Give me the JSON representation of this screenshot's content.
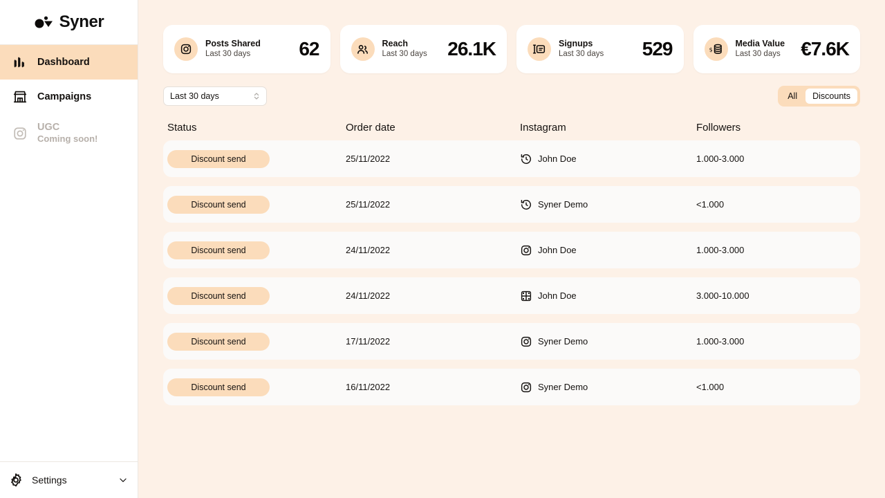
{
  "brand": {
    "name": "Syner",
    "logo_icon": "syner-logo-icon"
  },
  "colors": {
    "page_bg": "#FDF1E7",
    "accent": "#FBDCBB",
    "card_bg": "#FFFFFF",
    "row_bg": "#FBFAF9",
    "text": "#14110F",
    "muted": "#B7B0AA"
  },
  "sidebar": {
    "items": [
      {
        "label": "Dashboard",
        "icon": "bar-chart-icon",
        "active": true,
        "sub": ""
      },
      {
        "label": "Campaigns",
        "icon": "storefront-icon",
        "active": false,
        "sub": ""
      },
      {
        "label": "UGC",
        "icon": "instagram-icon",
        "active": false,
        "sub": "Coming soon!"
      }
    ],
    "footer": {
      "label": "Settings",
      "icon": "gear-icon",
      "chevron": "chevron-down-icon"
    }
  },
  "stats": [
    {
      "title": "Posts Shared",
      "subtitle": "Last 30 days",
      "value": "62",
      "icon": "instagram-icon"
    },
    {
      "title": "Reach",
      "subtitle": "Last 30 days",
      "value": "26.1K",
      "icon": "users-icon"
    },
    {
      "title": "Signups",
      "subtitle": "Last 30 days",
      "value": "529",
      "icon": "signup-card-icon"
    },
    {
      "title": "Media Value",
      "subtitle": "Last 30 days",
      "value": "€7.6K",
      "icon": "money-stack-icon"
    }
  ],
  "controls": {
    "date_filter": {
      "value": "Last 30 days",
      "icon": "stepper-icon"
    },
    "segmented": {
      "options": [
        "All",
        "Discounts"
      ],
      "selected": "Discounts"
    }
  },
  "table": {
    "columns": [
      "Status",
      "Order date",
      "Instagram",
      "Followers"
    ],
    "rows": [
      {
        "status": "Discount send",
        "date": "25/11/2022",
        "account": "John Doe",
        "icon": "story-clock-icon",
        "followers": "1.000-3.000"
      },
      {
        "status": "Discount send",
        "date": "25/11/2022",
        "account": "Syner Demo",
        "icon": "story-clock-icon",
        "followers": "<1.000"
      },
      {
        "status": "Discount send",
        "date": "24/11/2022",
        "account": "John Doe",
        "icon": "instagram-icon",
        "followers": "1.000-3.000"
      },
      {
        "status": "Discount send",
        "date": "24/11/2022",
        "account": "John Doe",
        "icon": "reel-film-icon",
        "followers": "3.000-10.000"
      },
      {
        "status": "Discount send",
        "date": "17/11/2022",
        "account": "Syner Demo",
        "icon": "instagram-icon",
        "followers": "1.000-3.000"
      },
      {
        "status": "Discount send",
        "date": "16/11/2022",
        "account": "Syner Demo",
        "icon": "instagram-icon",
        "followers": "<1.000"
      }
    ]
  }
}
